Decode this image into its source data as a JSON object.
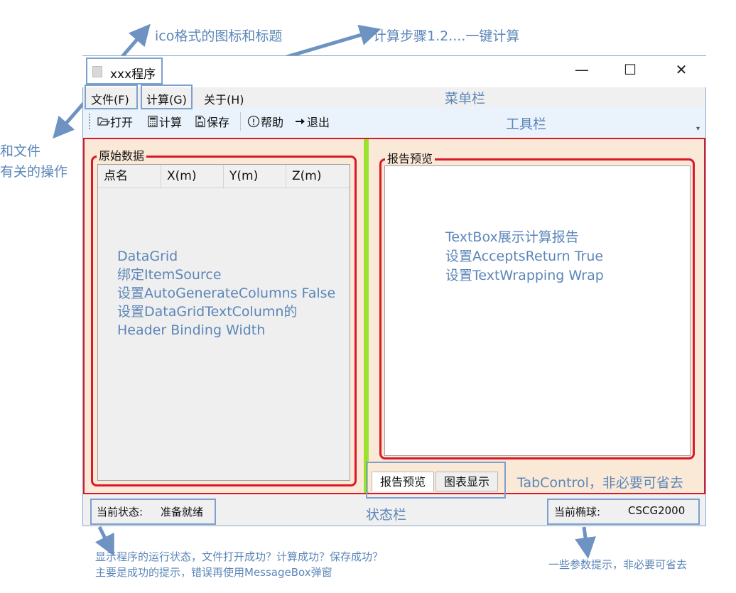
{
  "window": {
    "title": "xxx程序",
    "controls": {
      "minimize": "—",
      "maximize": "☐",
      "close": "✕"
    }
  },
  "menu": [
    "文件(F)",
    "计算(G)",
    "关于(H)"
  ],
  "toolbar": [
    {
      "icon": "open-icon",
      "label": "打开"
    },
    {
      "icon": "calculator-icon",
      "label": "计算"
    },
    {
      "icon": "save-icon",
      "label": "保存"
    },
    {
      "icon": "info-icon",
      "label": "帮助"
    },
    {
      "icon": "exit-icon",
      "label": "退出"
    }
  ],
  "left_panel": {
    "group_title": "原始数据",
    "columns": [
      "点名",
      "X(m)",
      "Y(m)",
      "Z(m)"
    ]
  },
  "right_panel": {
    "group_title": "报告预览",
    "tabs": [
      "报告预览",
      "图表显示"
    ]
  },
  "status_bar": {
    "status_label": "当前状态:",
    "status_value": "准备就绪",
    "ellipsoid_label": "当前椭球:",
    "ellipsoid_value": "CSCG2000"
  },
  "annotations": {
    "icon_title": "ico格式的图标和标题",
    "calc_steps": "计算步骤1.2....一键计算",
    "file_ops_1": "和文件",
    "file_ops_2": "有关的操作",
    "menubar": "菜单栏",
    "toolbar": "工具栏",
    "datagrid": [
      "DataGrid",
      "绑定ItemSource",
      "设置AutoGenerateColumns False",
      "设置DataGridTextColumn的",
      "Header Binding Width"
    ],
    "textbox": [
      "TextBox展示计算报告",
      "设置AcceptsReturn True",
      "设置TextWrapping Wrap"
    ],
    "tabcontrol": "TabControl，非必要可省去",
    "statusbar": "状态栏",
    "status_hint_1": "显示程序的运行状态，文件打开成功？计算成功？保存成功？",
    "status_hint_2": "主要是成功的提示，错误再使用MessageBox弹窗",
    "param_hint": "一些参数提示，非必要可省去"
  },
  "colors": {
    "annotation": "#5b86b8",
    "highlight_box": "#7da0cc",
    "region_border": "#d9182a",
    "splitter": "#9be22e",
    "content_bg": "#fbe9d8",
    "toolbar_bg": "#eaf2fb"
  }
}
